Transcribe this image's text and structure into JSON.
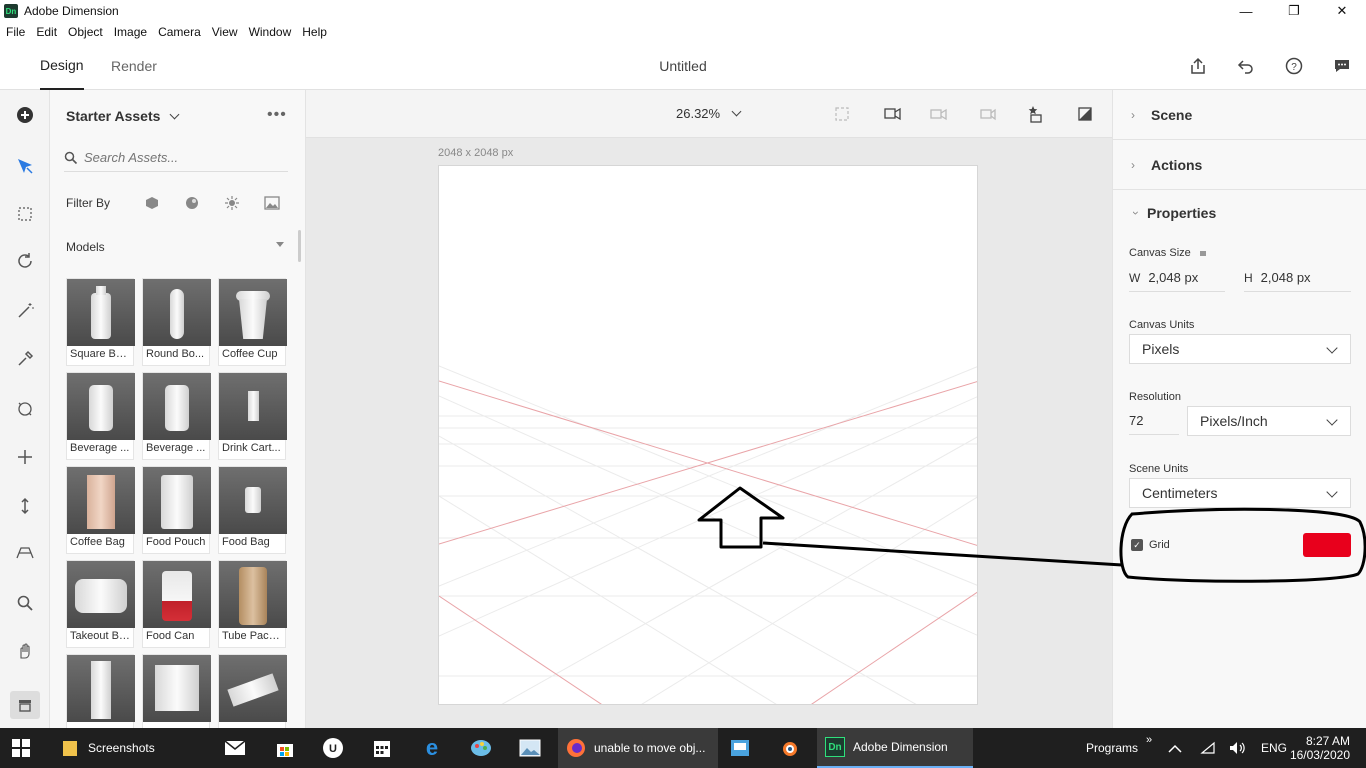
{
  "window": {
    "app_logo": "Dn",
    "title": "Adobe Dimension",
    "minimize": "—",
    "maximize": "❐",
    "close": "✕"
  },
  "menu": [
    "File",
    "Edit",
    "Object",
    "Image",
    "Camera",
    "View",
    "Window",
    "Help"
  ],
  "tabs": {
    "design": "Design",
    "render": "Render"
  },
  "document_title": "Untitled",
  "assets": {
    "title": "Starter Assets",
    "search_placeholder": "Search Assets...",
    "filter_by": "Filter By",
    "models_label": "Models",
    "items": [
      {
        "label": "Square Bo..."
      },
      {
        "label": "Round Bo..."
      },
      {
        "label": "Coffee Cup"
      },
      {
        "label": "Beverage ..."
      },
      {
        "label": "Beverage ..."
      },
      {
        "label": "Drink Cart..."
      },
      {
        "label": "Coffee Bag"
      },
      {
        "label": "Food Pouch"
      },
      {
        "label": "Food Bag"
      },
      {
        "label": "Takeout Box"
      },
      {
        "label": "Food Can"
      },
      {
        "label": "Tube Pack..."
      },
      {
        "label": ""
      },
      {
        "label": ""
      },
      {
        "label": ""
      }
    ]
  },
  "viewport": {
    "zoom": "26.32%",
    "canvas_size": "2048 x 2048 px"
  },
  "panel": {
    "scene": "Scene",
    "actions": "Actions",
    "properties": "Properties",
    "canvas_size_label": "Canvas Size",
    "w_label": "W",
    "w_value": "2,048 px",
    "h_label": "H",
    "h_value": "2,048 px",
    "canvas_units_label": "Canvas Units",
    "canvas_units": "Pixels",
    "resolution_label": "Resolution",
    "resolution_value": "72",
    "resolution_units": "Pixels/Inch",
    "scene_units_label": "Scene Units",
    "scene_units": "Centimeters",
    "grid_label": "Grid",
    "grid_checked": true,
    "grid_color": "#e8001c"
  },
  "taskbar": {
    "screenshots": "Screenshots",
    "firefox_title": "unable to move obj...",
    "dimension_title": "Adobe Dimension",
    "dimension_logo": "Dn",
    "programs": "Programs",
    "lang": "ENG",
    "time": "8:27 AM",
    "date": "16/03/2020"
  }
}
